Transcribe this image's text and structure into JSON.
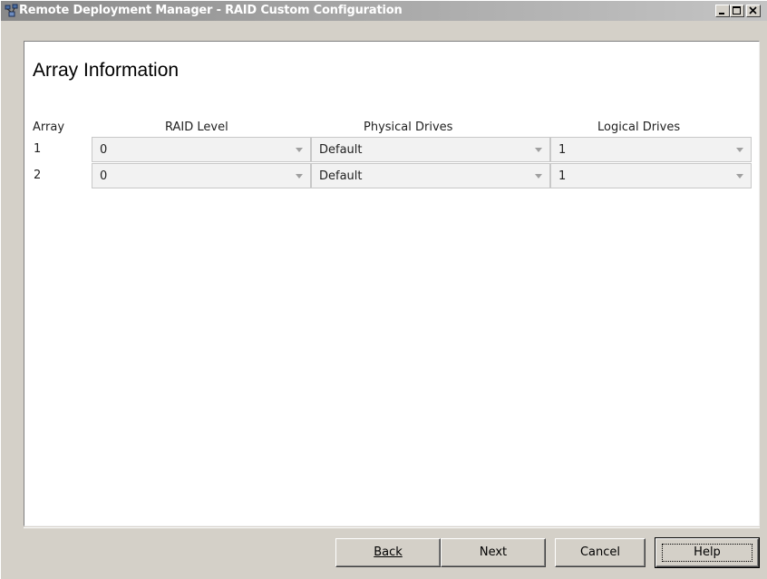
{
  "window": {
    "title": "Remote Deployment Manager - RAID Custom Configuration"
  },
  "page": {
    "heading": "Array Information"
  },
  "table": {
    "headers": {
      "array": "Array",
      "raid_level": "RAID Level",
      "physical_drives": "Physical Drives",
      "logical_drives": "Logical Drives"
    },
    "rows": [
      {
        "array": "1",
        "raid_level": "0",
        "physical_drives": "Default",
        "logical_drives": "1"
      },
      {
        "array": "2",
        "raid_level": "0",
        "physical_drives": "Default",
        "logical_drives": "1"
      }
    ]
  },
  "buttons": {
    "back": "Back",
    "next": "Next",
    "cancel": "Cancel",
    "help": "Help"
  },
  "icons": {
    "app": "app-network-icon",
    "minimize": "minimize-icon",
    "maximize": "maximize-icon",
    "close": "close-icon",
    "dropdown": "chevron-down-icon"
  }
}
